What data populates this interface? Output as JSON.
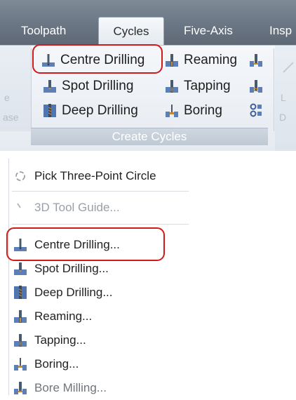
{
  "ribbon": {
    "tabs": [
      {
        "label": "Toolpath"
      },
      {
        "label": "Cycles"
      },
      {
        "label": "Five-Axis"
      },
      {
        "label": "Insp"
      }
    ],
    "left_group_faded": {
      "line1": "e",
      "line2": "ase"
    },
    "right_group_faded": {
      "line1": "L",
      "line2": "D"
    },
    "create_cycles": {
      "label": "Create Cycles",
      "items": [
        {
          "label": "Centre Drilling",
          "icon": "centre-drilling-icon"
        },
        {
          "label": "Spot Drilling",
          "icon": "spot-drilling-icon"
        },
        {
          "label": "Deep Drilling",
          "icon": "deep-drilling-icon"
        },
        {
          "label": "Reaming",
          "icon": "reaming-icon"
        },
        {
          "label": "Tapping",
          "icon": "tapping-icon"
        },
        {
          "label": "Boring",
          "icon": "boring-icon"
        }
      ]
    },
    "highlight_color": "#d11a1a"
  },
  "menu": {
    "items": [
      {
        "label": "Pick Three-Point Circle",
        "icon": "circle-icon"
      },
      {
        "label": "3D Tool Guide...",
        "icon": "tool-guide-icon"
      },
      {
        "label": "Centre Drilling...",
        "icon": "centre-drilling-icon"
      },
      {
        "label": "Spot Drilling...",
        "icon": "spot-drilling-icon"
      },
      {
        "label": "Deep Drilling...",
        "icon": "deep-drilling-icon"
      },
      {
        "label": "Reaming...",
        "icon": "reaming-icon"
      },
      {
        "label": "Tapping...",
        "icon": "tapping-icon"
      },
      {
        "label": "Boring...",
        "icon": "boring-icon"
      },
      {
        "label": "Bore Milling...",
        "icon": "bore-milling-icon"
      }
    ]
  }
}
